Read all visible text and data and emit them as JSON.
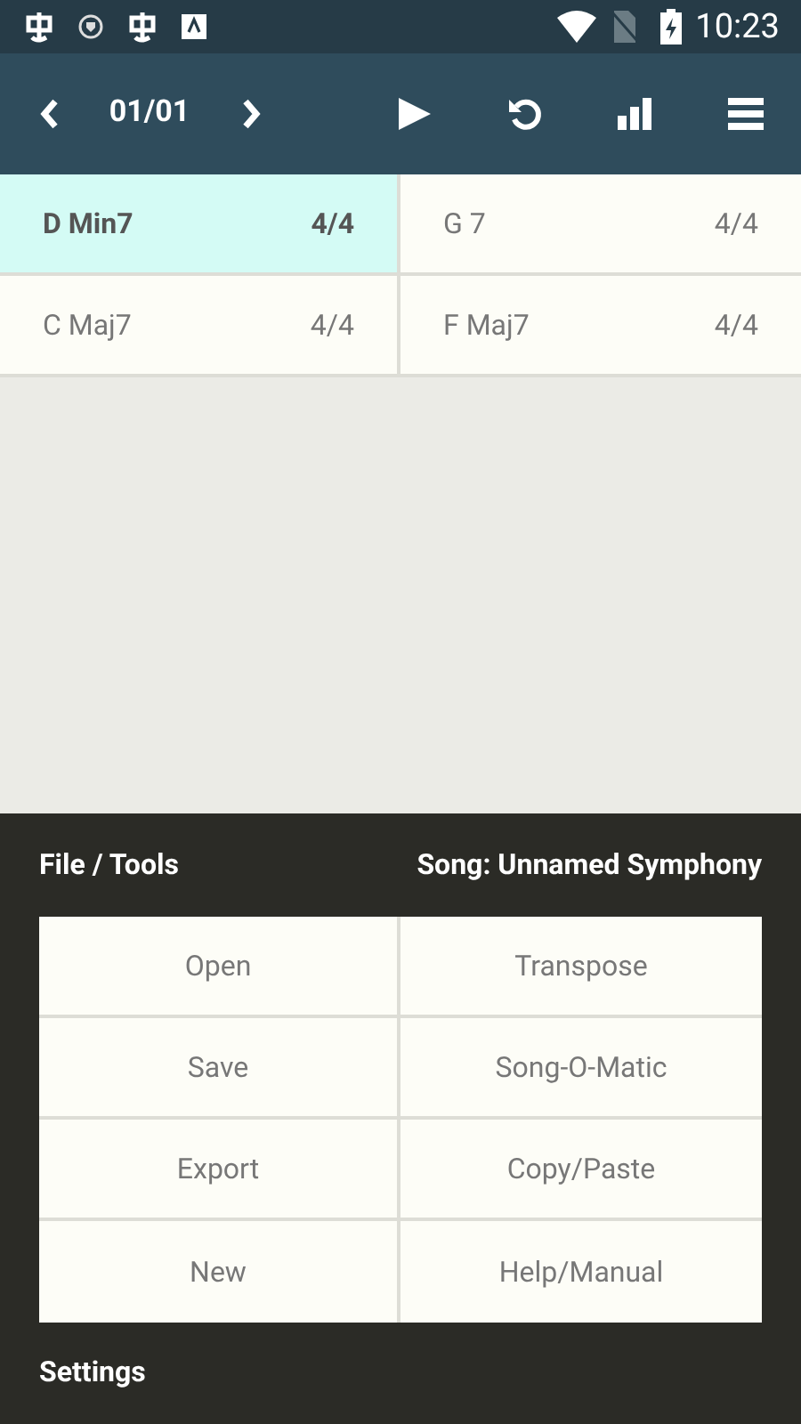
{
  "status_bar": {
    "time": "10:23"
  },
  "toolbar": {
    "page": "01/01"
  },
  "chords": [
    {
      "name": "D Min7",
      "meter": "4/4",
      "selected": true
    },
    {
      "name": "G 7",
      "meter": "4/4",
      "selected": false
    },
    {
      "name": "C Maj7",
      "meter": "4/4",
      "selected": false
    },
    {
      "name": "F Maj7",
      "meter": "4/4",
      "selected": false
    }
  ],
  "panel": {
    "title": "File / Tools",
    "song": "Song: Unnamed Symphony",
    "buttons": [
      "Open",
      "Transpose",
      "Save",
      "Song-O-Matic",
      "Export",
      "Copy/Paste",
      "New",
      "Help/Manual"
    ],
    "footer": "Settings"
  }
}
